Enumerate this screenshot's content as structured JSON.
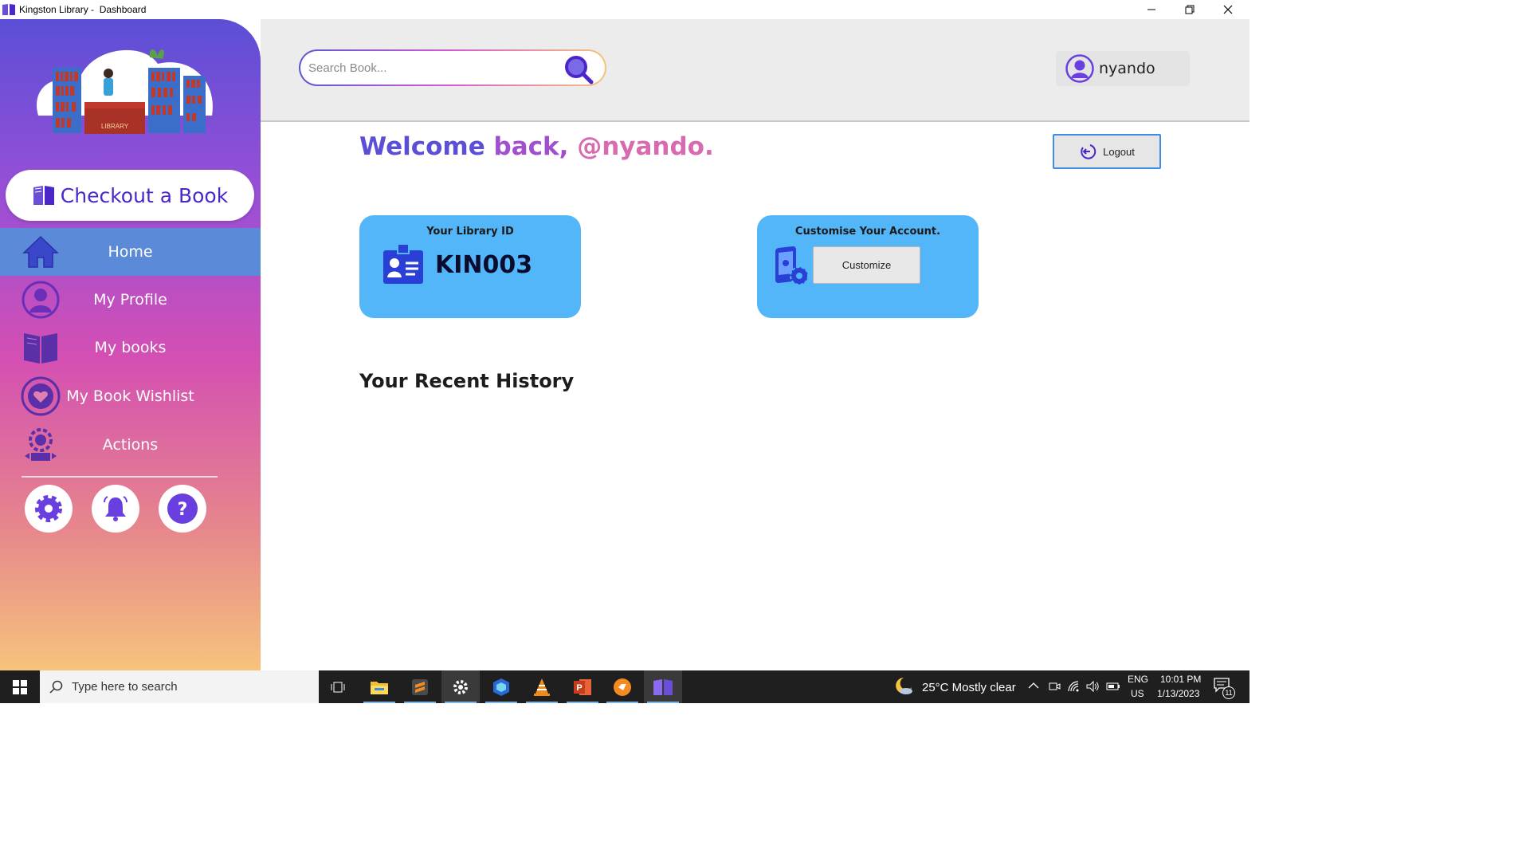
{
  "window": {
    "title": "Kingston Library -  Dashboard"
  },
  "sidebar": {
    "checkout_label": "Checkout a Book",
    "items": [
      {
        "label": "Home",
        "icon": "home-icon",
        "active": true
      },
      {
        "label": "My Profile",
        "icon": "profile-icon",
        "active": false
      },
      {
        "label": "My books",
        "icon": "book-icon",
        "active": false
      },
      {
        "label": "My Book Wishlist",
        "icon": "heart-icon",
        "active": false
      },
      {
        "label": "Actions",
        "icon": "actions-icon",
        "active": false
      }
    ],
    "illustration_text": "LIBRARY",
    "bottom_buttons": [
      "gear-icon",
      "bell-icon",
      "help-icon"
    ]
  },
  "header": {
    "search_placeholder": "Search Book...",
    "username": "nyando"
  },
  "main": {
    "welcome_1": "Welcome",
    "welcome_2": " back,",
    "welcome_3": " @nyando.",
    "logout_label": "Logout",
    "library_id_title": "Your Library ID",
    "library_id": "KIN003",
    "customise_title": "Customise Your Account.",
    "customize_label": "Customize",
    "history_title": "Your Recent History"
  },
  "taskbar": {
    "search_placeholder": "Type here to search",
    "weather": "25°C  Mostly clear",
    "lang": "ENG",
    "region": "US",
    "time": "10:01 PM",
    "date": "1/13/2023",
    "notification_count": "11"
  },
  "colors": {
    "accent": "#4b27c9",
    "card": "#53b6f9",
    "sidebar_active": "#5b8ad9"
  }
}
